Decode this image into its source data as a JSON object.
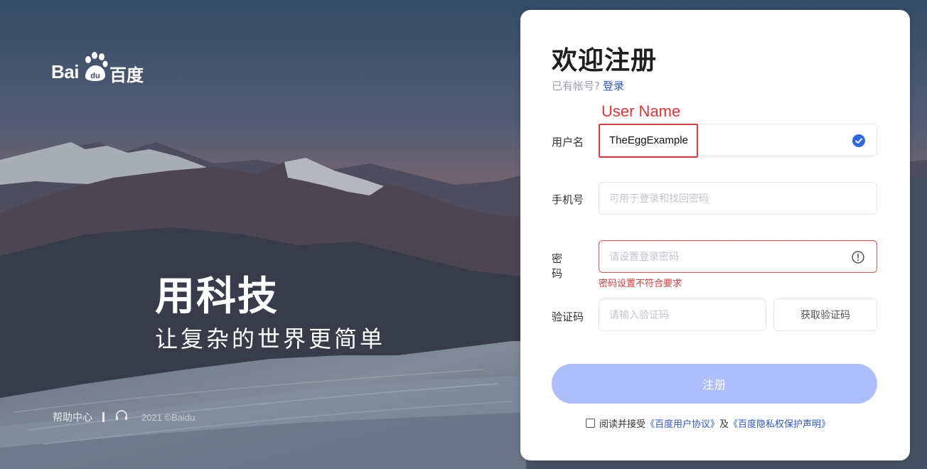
{
  "brand": {
    "logo_latin": "Bai",
    "logo_chinese": "百度",
    "slogan_main": "用科技",
    "slogan_sub": "让复杂的世界更简单",
    "help_center": "帮助中心",
    "copyright": "2021 ©Baidu"
  },
  "form": {
    "title": "欢迎注册",
    "have_account_text": "已有帐号?",
    "login_link": "登录",
    "annotation": "User Name",
    "username": {
      "label": "用户名",
      "value": "TheEggExample",
      "status": "valid"
    },
    "phone": {
      "label": "手机号",
      "placeholder": "可用于登录和找回密码"
    },
    "password": {
      "label": "密  码",
      "placeholder": "请设置登录密码",
      "error": "密码设置不符合要求"
    },
    "code": {
      "label": "验证码",
      "placeholder": "请输入验证码",
      "button": "获取验证码"
    },
    "submit": "注册",
    "agreement": {
      "prefix": "阅读并接受",
      "user_agreement": "《百度用户协议》",
      "and": "及",
      "privacy": "《百度隐私权保护声明》"
    }
  },
  "colors": {
    "accent": "#2e67e8",
    "link": "#2c57d8",
    "error": "#e23a3a",
    "submit_disabled": "#aebefa"
  },
  "icons": {
    "username_status": "check-circle-icon",
    "password_status": "exclamation-circle-icon",
    "help": "headset-icon",
    "logo": "paw-icon"
  }
}
